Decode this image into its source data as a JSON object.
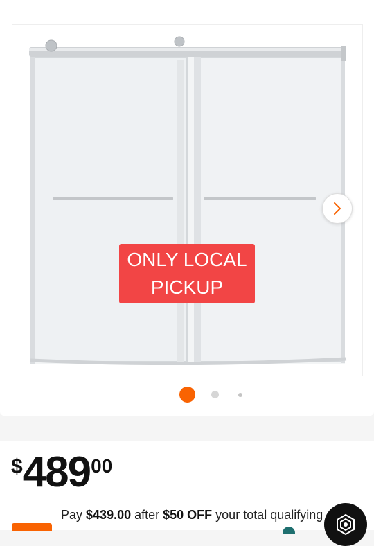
{
  "gallery": {
    "badge_line1": "ONLY LOCAL",
    "badge_line2": "PICKUP",
    "next_icon": "chevron-right-icon",
    "slide_count": 3,
    "active_slide": 1
  },
  "price": {
    "currency": "$",
    "whole": "489",
    "cents": "00"
  },
  "promo": {
    "prefix": "Pay ",
    "pay_amount": "$439.00",
    "middle": " after ",
    "discount": "$50 OFF",
    "suffix": " your total qualifying"
  },
  "colors": {
    "accent": "#f96302",
    "badge": "#f24545",
    "chat": "#111111"
  }
}
